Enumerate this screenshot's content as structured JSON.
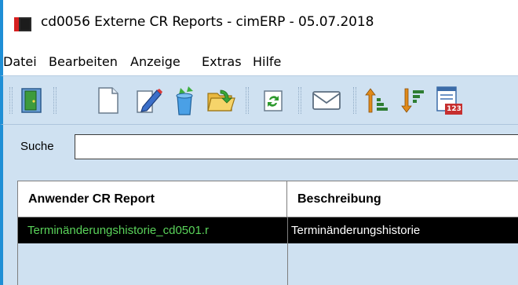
{
  "window": {
    "title": "cd0056 Externe CR Reports - cimERP - 05.07.2018"
  },
  "menu": {
    "items": [
      {
        "label": "Datei"
      },
      {
        "label": "Bearbeiten"
      },
      {
        "label": "Anzeige"
      },
      {
        "label": "Extras"
      },
      {
        "label": "Hilfe"
      }
    ]
  },
  "toolbar": {
    "buttons": [
      {
        "icon": "exit-door-icon"
      },
      {
        "icon": "new-document-icon"
      },
      {
        "icon": "edit-pencil-icon"
      },
      {
        "icon": "recycle-delete-icon"
      },
      {
        "icon": "open-folder-icon"
      },
      {
        "icon": "refresh-icon"
      },
      {
        "icon": "mail-envelope-icon"
      },
      {
        "icon": "sort-ascending-icon"
      },
      {
        "icon": "sort-descending-icon"
      },
      {
        "icon": "calendar-123-icon"
      }
    ],
    "calendar_badge": "123"
  },
  "search": {
    "label": "Suche",
    "value": ""
  },
  "grid": {
    "columns": [
      {
        "header": "Anwender CR Report"
      },
      {
        "header": "Beschreibung"
      }
    ],
    "rows": [
      {
        "cells": [
          "Terminänderungshistorie_cd0501.r",
          "Terminänderungshistorie"
        ],
        "selected": true
      }
    ]
  },
  "colors": {
    "accent": "#1f8fd6",
    "toolbar_bg": "#cfe1f1",
    "selected_row_bg": "#000000",
    "selected_text": "#5ad35a"
  }
}
